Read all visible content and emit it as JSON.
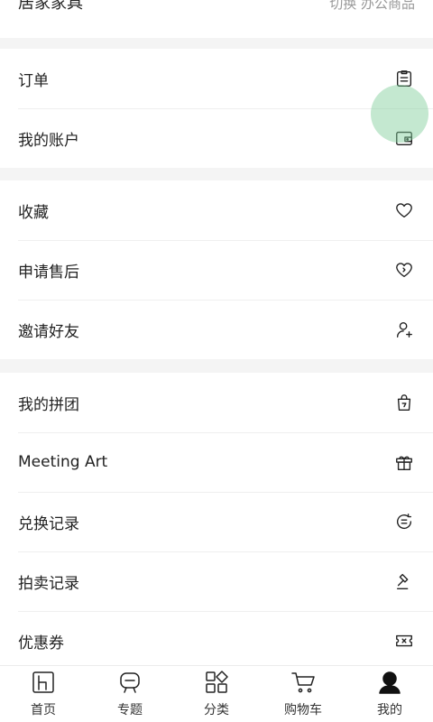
{
  "header": {
    "title": "居家家具",
    "switch_action": "切换 办公商品"
  },
  "groups": [
    {
      "items": [
        {
          "label": "订单",
          "icon": "order-list-icon"
        },
        {
          "label": "我的账户",
          "icon": "wallet-icon"
        }
      ]
    },
    {
      "items": [
        {
          "label": "收藏",
          "icon": "heart-icon"
        },
        {
          "label": "申请售后",
          "icon": "heart-service-icon"
        },
        {
          "label": "邀请好友",
          "icon": "invite-user-icon"
        }
      ]
    },
    {
      "items": [
        {
          "label": "我的拼团",
          "icon": "group-buy-bag-icon"
        },
        {
          "label": "Meeting Art",
          "icon": "gift-icon"
        },
        {
          "label": "兑换记录",
          "icon": "exchange-record-icon"
        },
        {
          "label": "拍卖记录",
          "icon": "auction-gavel-icon"
        },
        {
          "label": "优惠券",
          "icon": "coupon-icon"
        }
      ]
    }
  ],
  "tabbar": {
    "tabs": [
      {
        "label": "首页",
        "icon": "home-chair-icon"
      },
      {
        "label": "专题",
        "icon": "topic-chat-icon"
      },
      {
        "label": "分类",
        "icon": "category-grid-icon"
      },
      {
        "label": "购物车",
        "icon": "cart-icon"
      },
      {
        "label": "我的",
        "icon": "profile-icon",
        "active": true
      }
    ]
  }
}
